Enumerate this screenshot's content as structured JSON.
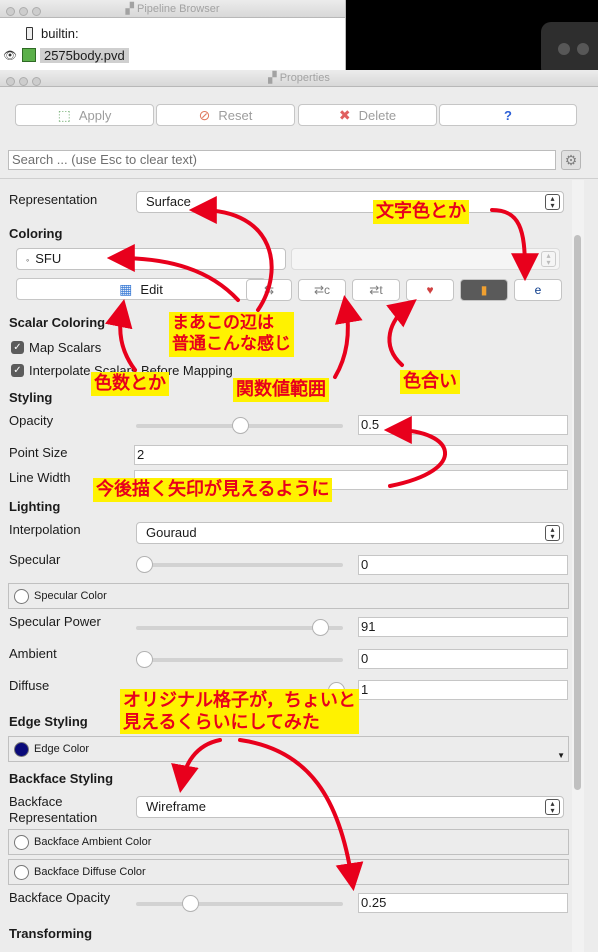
{
  "pipeline_browser": {
    "title": "Pipeline Browser",
    "items": [
      {
        "label": "builtin:",
        "icon": "server-icon"
      },
      {
        "label": "2575body.pvd",
        "icon": "dataset-cube-icon"
      }
    ]
  },
  "properties": {
    "title": "Properties",
    "toolbar": {
      "apply": "Apply",
      "reset": "Reset",
      "delete": "Delete",
      "help": "?"
    },
    "search_placeholder": "Search ... (use Esc to clear text)",
    "representation": {
      "label": "Representation",
      "value": "Surface"
    },
    "coloring": {
      "header": "Coloring",
      "array": "SFU",
      "edit": "Edit"
    },
    "scalar_coloring": {
      "header": "Scalar Coloring",
      "map_scalars": "Map Scalars",
      "interpolate": "Interpolate Scalars Before Mapping"
    },
    "styling": {
      "header": "Styling",
      "opacity": {
        "label": "Opacity",
        "value": "0.5",
        "fraction": 0.5
      },
      "point_size": {
        "label": "Point Size",
        "value": "2"
      },
      "line_width": {
        "label": "Line Width",
        "value": ""
      }
    },
    "lighting": {
      "header": "Lighting",
      "interpolation": {
        "label": "Interpolation",
        "value": "Gouraud"
      },
      "specular": {
        "label": "Specular",
        "value": "0",
        "fraction": 0.0
      },
      "specular_color": "Specular Color",
      "specular_power": {
        "label": "Specular Power",
        "value": "91",
        "fraction": 0.91
      },
      "ambient": {
        "label": "Ambient",
        "value": "0",
        "fraction": 0.0
      },
      "diffuse": {
        "label": "Diffuse",
        "value": "1",
        "fraction": 1.0
      }
    },
    "edge_styling": {
      "header": "Edge Styling",
      "edge_color": "Edge Color",
      "color": "#0a0a7a"
    },
    "backface_styling": {
      "header": "Backface Styling",
      "representation_label_1": "Backface",
      "representation_label_2": "Representation",
      "representation_value": "Wireframe",
      "ambient_color": "Backface Ambient Color",
      "diffuse_color": "Backface Diffuse Color",
      "opacity": {
        "label": "Backface Opacity",
        "value": "0.25",
        "fraction": 0.25
      }
    },
    "transforming": {
      "header": "Transforming"
    }
  },
  "annotations": {
    "text_color": "文字色とか",
    "edge_area_1": "まあこの辺は",
    "edge_area_2": "普通こんな感じ",
    "color_count": "色数とか",
    "value_range": "関数値範囲",
    "hue": "色合い",
    "arrow_note": "今後描く矢印が見えるように",
    "grid_note_1": "オリジナル格子が，ちょいと",
    "grid_note_2": "見えるくらいにしてみた",
    "arrow_color": "#e8001c",
    "box_color": "#fff200"
  }
}
